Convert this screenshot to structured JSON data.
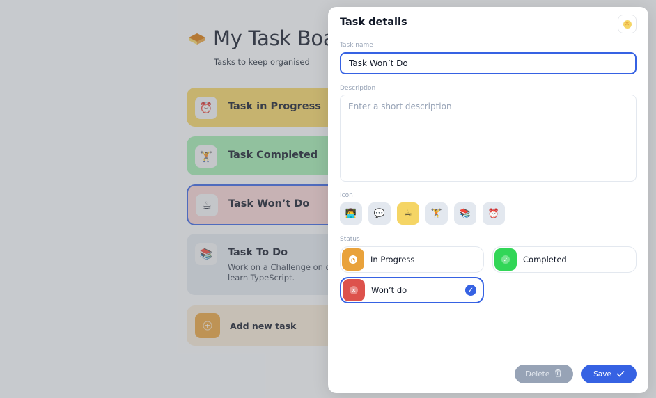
{
  "board": {
    "title": "My Task Board",
    "subtitle": "Tasks to keep organised",
    "tasks": [
      {
        "title": "Task in Progress",
        "icon": "alarm-clock-icon",
        "glyph": "⏰",
        "status": "in-progress"
      },
      {
        "title": "Task Completed",
        "icon": "weightlifter-icon",
        "glyph": "🏋",
        "status": "completed"
      },
      {
        "title": "Task Won’t Do",
        "icon": "coffee-icon",
        "glyph": "☕",
        "status": "wont-do"
      },
      {
        "title": "Task To Do",
        "icon": "books-icon",
        "glyph": "📚",
        "description_line1": "Work on a Challenge on dev",
        "description_line2": "learn TypeScript.",
        "status": "to-do"
      }
    ],
    "add_label": "Add new task"
  },
  "panel": {
    "title": "Task details",
    "name_label": "Task name",
    "name_value": "Task Won’t Do",
    "description_label": "Description",
    "description_placeholder": "Enter a short description",
    "icon_label": "Icon",
    "icons": [
      {
        "name": "technologist-icon",
        "glyph": "👨‍💻"
      },
      {
        "name": "speech-bubble-icon",
        "glyph": "💬"
      },
      {
        "name": "coffee-icon",
        "glyph": "☕",
        "selected": true
      },
      {
        "name": "weightlifter-icon",
        "glyph": "🏋"
      },
      {
        "name": "books-icon",
        "glyph": "📚"
      },
      {
        "name": "alarm-clock-icon",
        "glyph": "⏰"
      }
    ],
    "status_label": "Status",
    "statuses": [
      {
        "label": "In Progress",
        "color": "#e9a23b",
        "glyph": "◔"
      },
      {
        "label": "Completed",
        "color": "#32d657",
        "glyph": "✓"
      },
      {
        "label": "Won’t do",
        "color": "#dd524c",
        "glyph": "✕",
        "selected": true
      }
    ],
    "delete_label": "Delete",
    "save_label": "Save"
  },
  "colors": {
    "accent": "#3662e3",
    "in_progress": "#f5d565",
    "completed": "#a0ecb1",
    "wont_do": "#f7d4d3",
    "to_do": "#e3e8ef",
    "add": "#f5e8d5"
  }
}
